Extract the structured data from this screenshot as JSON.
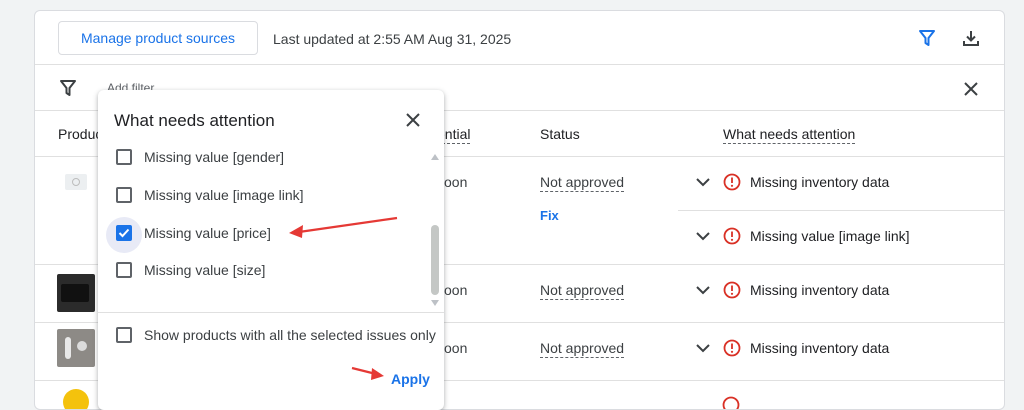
{
  "toolbar": {
    "manage_label": "Manage product sources",
    "last_updated": "Last updated at 2:55 AM Aug 31, 2025"
  },
  "filterbar": {
    "add_filter": "Add filter"
  },
  "table": {
    "headers": {
      "product": "Produc",
      "potential": "ential",
      "status": "Status",
      "attention": "What needs attention"
    },
    "rows": [
      {
        "potential": "soon",
        "status": "Not approved",
        "fix": "Fix",
        "issues": [
          "Missing inventory data",
          "Missing value [image link]"
        ]
      },
      {
        "potential": "soon",
        "status": "Not approved",
        "issues": [
          "Missing inventory data"
        ]
      },
      {
        "potential": "soon",
        "status": "Not approved",
        "issues": [
          "Missing inventory data"
        ]
      }
    ]
  },
  "popup": {
    "title": "What needs attention",
    "options": [
      {
        "label": "Missing value [gender]",
        "checked": false
      },
      {
        "label": "Missing value [image link]",
        "checked": false
      },
      {
        "label": "Missing value [price]",
        "checked": true
      },
      {
        "label": "Missing value [size]",
        "checked": false
      }
    ],
    "only_selected_label": "Show products with all the selected issues only",
    "apply_label": "Apply"
  },
  "colors": {
    "accent": "#1a73e8",
    "error": "#d93025",
    "annotation_arrow": "#e53935"
  },
  "icons": [
    "filter-icon",
    "download-icon",
    "close-icon",
    "chevron-down-icon",
    "error-circle-icon"
  ]
}
